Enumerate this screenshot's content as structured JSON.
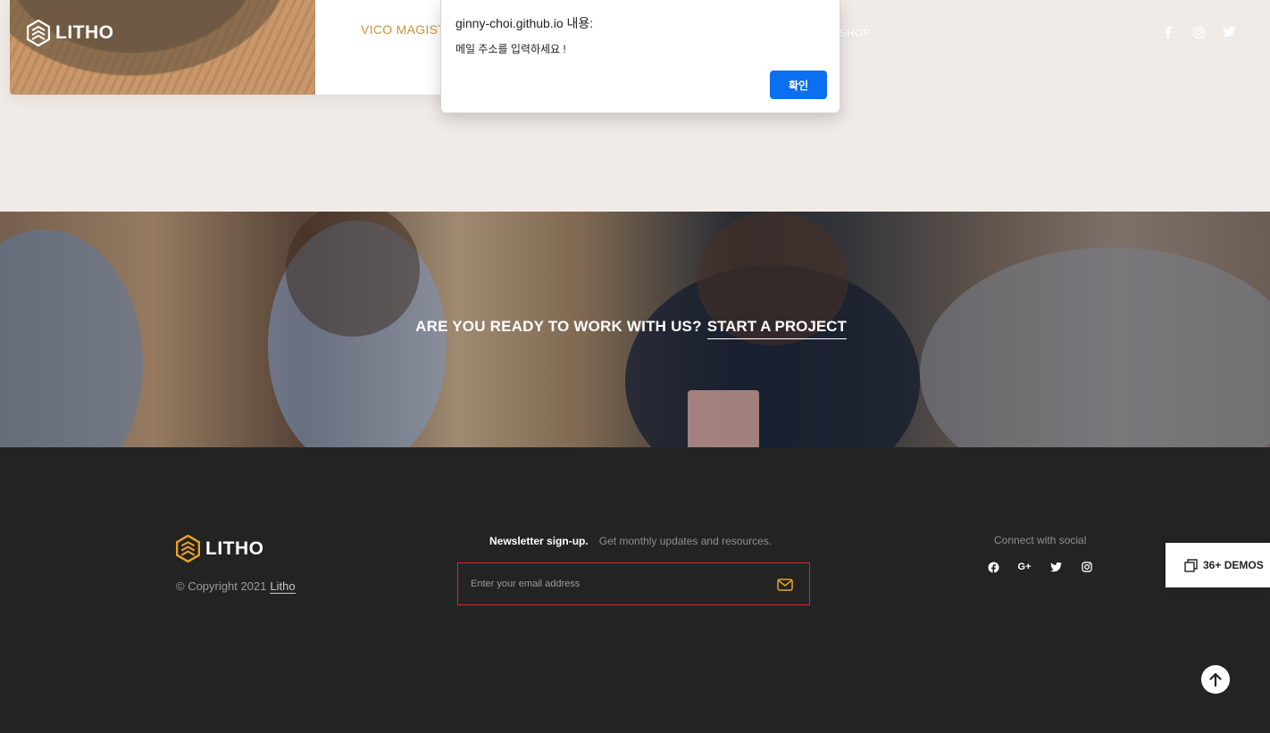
{
  "header": {
    "logo_text": "LITHO",
    "nav_shop": "SHOP",
    "social_icons": [
      "facebook-icon",
      "instagram-icon",
      "twitter-icon"
    ]
  },
  "product": {
    "name": "VICO MAGISTRETTI"
  },
  "dialog": {
    "title": "ginny-choi.github.io 내용:",
    "message": "메일 주소를 입력하세요 !",
    "ok_label": "확인"
  },
  "banner": {
    "question": "ARE YOU READY TO WORK WITH US?",
    "link": "START A PROJECT"
  },
  "footer": {
    "logo_text": "LITHO",
    "copyright_prefix": "© Copyright 2021",
    "copyright_link": "Litho",
    "newsletter_title": "Newsletter sign-up.",
    "newsletter_subtitle": "Get monthly updates and resources.",
    "email_placeholder": "Enter your email address",
    "connect_title": "Connect with social",
    "social_icons": [
      "facebook-icon",
      "google-plus-icon",
      "twitter-icon",
      "instagram-icon"
    ]
  },
  "floating": {
    "demos_label": "36+ DEMOS"
  },
  "colors": {
    "accent_gold": "#ca943b",
    "dialog_button": "#0b6ff2",
    "footer_bg": "#232323",
    "input_border": "#d92a2a"
  }
}
